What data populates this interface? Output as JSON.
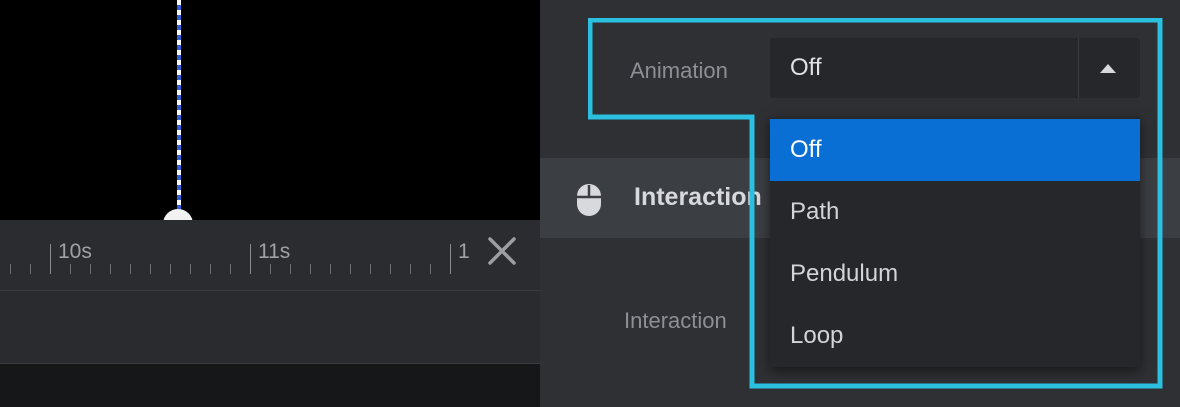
{
  "timeline": {
    "tick_labels": [
      "10s",
      "11s",
      "1"
    ],
    "close_icon": "close-icon",
    "playhead_icon": "playhead-icon"
  },
  "panel": {
    "animation_label": "Animation",
    "animation_value": "Off",
    "section_title": "Interaction",
    "section_icon": "mouse-icon",
    "interaction_label": "Interaction"
  },
  "dropdown": {
    "options": [
      "Off",
      "Path",
      "Pendulum",
      "Loop"
    ],
    "selected": "Off"
  },
  "colors": {
    "highlight": "#2bbfe0",
    "selected_option": "#0a6fd4"
  }
}
